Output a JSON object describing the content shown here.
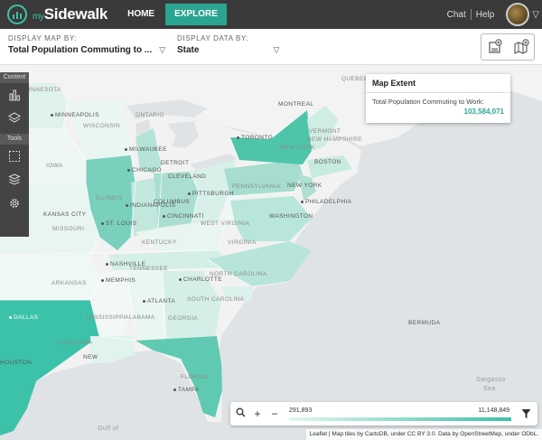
{
  "app": {
    "logo_prefix": "my",
    "logo_name": "Sidewalk"
  },
  "nav": {
    "home": "HOME",
    "explore": "EXPLORE",
    "chat": "Chat",
    "help": "Help"
  },
  "selectors": {
    "map_by_label": "DISPLAY MAP BY:",
    "map_by_value": "Total Population Commuting to ...",
    "data_by_label": "DISPLAY DATA BY:",
    "data_by_value": "State"
  },
  "left_panel": {
    "content_header": "Content",
    "tools_header": "Tools"
  },
  "extent_card": {
    "title": "Map Extent",
    "label": "Total Population Commuting to Work:",
    "value": "103,584,071"
  },
  "legend": {
    "min": "291,893",
    "max": "11,148,849"
  },
  "attribution": "Leaflet | Map tiles by CartoDB, under CC BY 3.0. Data by OpenStreetMap, under ODbL.",
  "map_labels": {
    "minnesota": "MINNESOTA",
    "minneapolis": "MINNEAPOLIS",
    "wisconsin": "WISCONSIN",
    "iowa": "IOWA",
    "milwaukee": "MILWAUKEE",
    "chicago": "CHICAGO",
    "detroit": "DETROIT",
    "toronto": "TORONTO",
    "montreal": "MONTREAL",
    "quebec": "QUEBEC",
    "vermont": "VERMONT",
    "new_hampshire": "NEW HAMPSHIRE",
    "new_york_state": "NEW YORK",
    "boston": "BOSTON",
    "new_york_city": "NEW YORK",
    "cleveland": "CLEVELAND",
    "pittsburgh": "PITTSBURGH",
    "pennsylvania": "PENNSYLVANIA",
    "philadelphia": "PHILADELPHIA",
    "washington": "WASHINGTON",
    "illinois": "ILLINOIS",
    "indianapolis": "INDIANAPOLIS",
    "columbus": "COLUMBUS",
    "cincinnati": "CINCINNATI",
    "kansas_city": "KANSAS CITY",
    "missouri": "MISSOURI",
    "st_louis": "ST. LOUIS",
    "west_virginia": "WEST VIRGINIA",
    "virginia": "VIRGINIA",
    "kentucky": "KENTUCKY",
    "nashville": "NASHVILLE",
    "tennessee": "TENNESSEE",
    "memphis": "MEMPHIS",
    "arkansas": "ARKANSAS",
    "charlotte": "CHARLOTTE",
    "north_carolina": "NORTH CAROLINA",
    "south_carolina": "SOUTH CAROLINA",
    "atlanta": "ATLANTA",
    "mississippi": "MISSISSIPPI",
    "alabama": "ALABAMA",
    "georgia": "GEORGIA",
    "dallas": "DALLAS",
    "louisiana": "LOUISIANA",
    "houston": "HOUSTON",
    "new_orleans": "NEW",
    "florida": "FLORIDA",
    "tampa": "TAMPA",
    "bermuda": "BERMUDA",
    "sargasso": "Sargasso",
    "sea": "Sea",
    "gulf": "Gulf of",
    "ontario": "ONTARIO"
  },
  "colors": {
    "accent": "#2aa58f",
    "nav_bg": "#3a3a3a",
    "choropleth_low": "#e4f5f0",
    "choropleth_high": "#3cc2a8"
  }
}
